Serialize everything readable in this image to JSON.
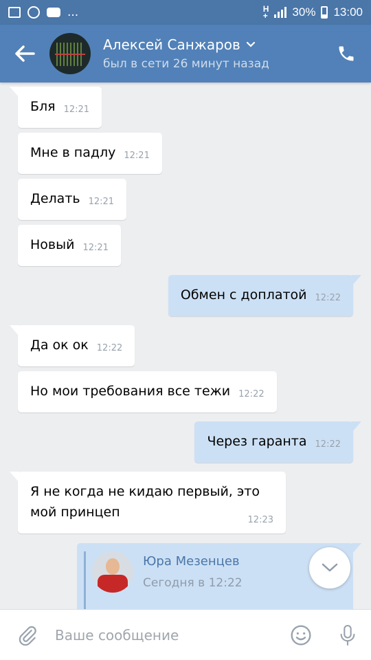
{
  "status_bar": {
    "battery": "30%",
    "time": "13:00",
    "dots": "..."
  },
  "header": {
    "back_icon": "arrow-left-icon",
    "name": "Алексей Санжаров",
    "status": "был в сети 26 минут назад",
    "call_icon": "phone-icon"
  },
  "messages": [
    {
      "dir": "in",
      "text": "Бля",
      "time": "12:21"
    },
    {
      "dir": "in",
      "text": "Мне в падлу",
      "time": "12:21"
    },
    {
      "dir": "in",
      "text": "Делать",
      "time": "12:21"
    },
    {
      "dir": "in",
      "text": "Новый",
      "time": "12:21"
    },
    {
      "dir": "out",
      "text": "Обмен с доплатой",
      "time": "12:22"
    },
    {
      "dir": "in",
      "text": "Да ок ок",
      "time": "12:22"
    },
    {
      "dir": "in",
      "text": "Но мои требования все тежи",
      "time": "12:22"
    },
    {
      "dir": "out",
      "text": "Через гаранта",
      "time": "12:22"
    },
    {
      "dir": "in",
      "text": "Я не когда не кидаю первый, это мой принцеп",
      "time": "12:23"
    }
  ],
  "forwarded": {
    "author": "Юра Мезенцев",
    "time": "Сегодня в 12:22"
  },
  "input": {
    "placeholder": "Ваше сообщение"
  },
  "colors": {
    "header": "#5181b8",
    "status_bar": "#4a76a8",
    "outgoing_bubble": "#cce0f5",
    "incoming_bubble": "#ffffff",
    "background": "#edeef0"
  }
}
